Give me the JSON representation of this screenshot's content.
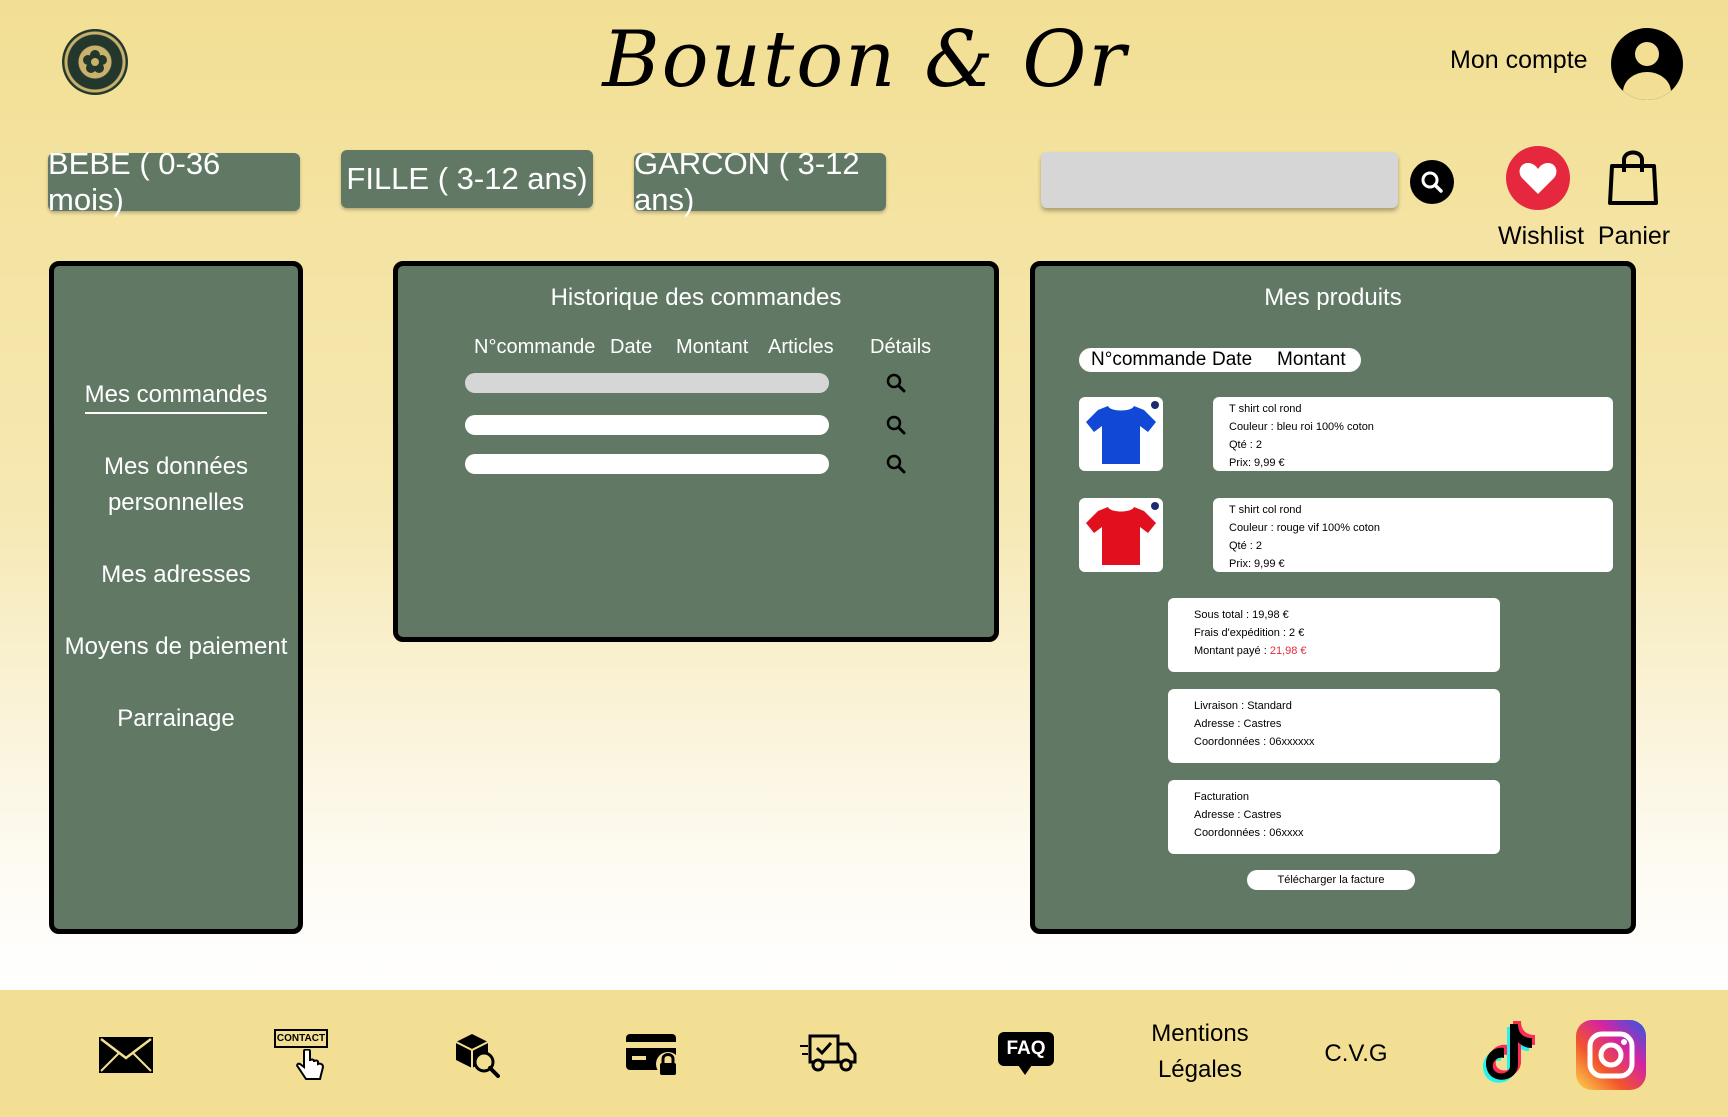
{
  "header": {
    "brand": "Bouton & Or",
    "account_label": "Mon compte"
  },
  "nav": {
    "categories": [
      "BEBE ( 0-36 mois)",
      "FILLE ( 3-12 ans)",
      "GARCON ( 3-12 ans)"
    ],
    "search_placeholder": "",
    "wishlist_label": "Wishlist",
    "cart_label": "Panier"
  },
  "sidebar": {
    "items": [
      {
        "label": "Mes commandes",
        "active": true
      },
      {
        "label": "Mes données personnelles",
        "active": false
      },
      {
        "label": "Mes adresses",
        "active": false
      },
      {
        "label": "Moyens de paiement",
        "active": false
      },
      {
        "label": "Parrainage",
        "active": false
      }
    ]
  },
  "history": {
    "title": "Historique des commandes",
    "columns": [
      "N°commande",
      "Date",
      "Montant",
      "Articles",
      "Détails"
    ]
  },
  "products": {
    "title": "Mes produits",
    "columns": [
      "N°commande",
      "Date",
      "Montant"
    ],
    "items": [
      {
        "name": "T shirt col rond",
        "color": "Couleur : bleu roi 100% coton",
        "qty": "Qté : 2",
        "price": "Prix: 9,99 €",
        "swatch": "#1149d6"
      },
      {
        "name": "T shirt col rond",
        "color": "Couleur : rouge vif 100% coton",
        "qty": "Qté : 2",
        "price": "Prix: 9,99 €",
        "swatch": "#e0101e"
      }
    ],
    "totals": {
      "subtotal": "Sous total : 19,98 €",
      "shipping": "Frais d'expédition : 2 €",
      "paid_label": "Montant payé : ",
      "paid_value": "21,98 €"
    },
    "delivery": {
      "mode": "Livraison : Standard",
      "address": "Adresse : Castres",
      "contact": "Coordonnées : 06xxxxxx"
    },
    "billing": {
      "title": "Facturation",
      "address": "Adresse : Castres",
      "contact": "Coordonnées : 06xxxx"
    },
    "invoice_button": "Télécharger la facture"
  },
  "footer": {
    "icons": [
      "mail-icon",
      "contact-icon",
      "order-tracking-icon",
      "secure-payment-icon",
      "delivery-icon",
      "faq-icon"
    ],
    "contact_tag": "CONTACT",
    "faq_tag": "FAQ",
    "legal_line1": "Mentions",
    "legal_line2": "Légales",
    "cvg": "C.V.G"
  },
  "colors": {
    "background": "#f2df94",
    "panel": "#617964",
    "accent_red": "#e6283f"
  }
}
